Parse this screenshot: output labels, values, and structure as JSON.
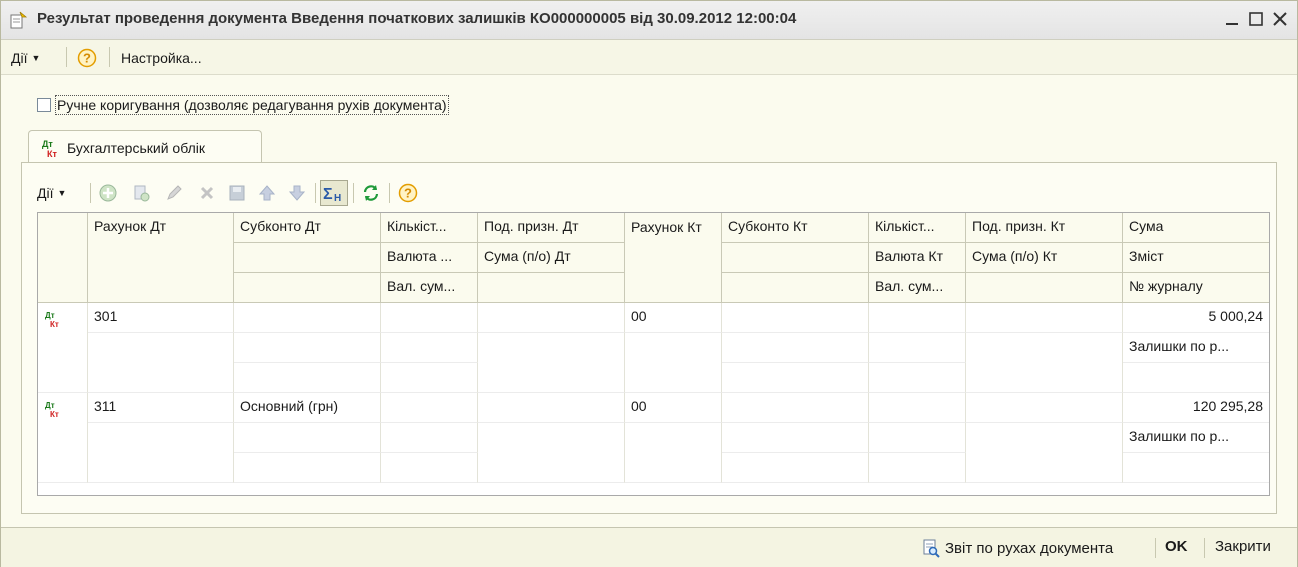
{
  "window": {
    "title": "Результат проведення документа Введення початкових залишків КО000000005 від 30.09.2012 12:00:04"
  },
  "main_toolbar": {
    "actions_label": "Дії",
    "settings_label": "Настройка..."
  },
  "manual_edit": {
    "label": "Ручне коригування (дозволяє редагування рухів документа)",
    "checked": false
  },
  "tabs": [
    {
      "label": "Бухгалтерський облік",
      "icon": "dt-kt-icon",
      "active": true
    }
  ],
  "inner_toolbar": {
    "actions_label": "Дії",
    "icons": [
      "add-icon",
      "copy-icon",
      "edit-icon",
      "delete-icon",
      "post-icon",
      "move-up-icon",
      "move-down-icon",
      "sum-icon",
      "refresh-icon",
      "help-icon"
    ]
  },
  "table": {
    "headers": {
      "account_dt": "Рахунок Дт",
      "subconto_dt": "Субконто Дт",
      "qty_dt": "Кількіст...",
      "currency_dt": "Валюта ...",
      "cur_sum_dt": "Вал. сум...",
      "tax_dt": "Под. призн. Дт",
      "sum_tax_dt": "Сума (п/о) Дт",
      "account_kt": "Рахунок Кт",
      "subconto_kt": "Субконто Кт",
      "qty_kt": "Кількіст...",
      "currency_kt": "Валюта Кт",
      "cur_sum_kt": "Вал. сум...",
      "tax_kt": "Под. призн. Кт",
      "sum_tax_kt": "Сума (п/о) Кт",
      "amount": "Сума",
      "content": "Зміст",
      "journal_no": "№ журналу"
    },
    "rows": [
      {
        "account_dt": "301",
        "subconto_dt": "",
        "account_kt": "00",
        "amount": "5 000,24",
        "content": "Залишки по р..."
      },
      {
        "account_dt": "311",
        "subconto_dt": "Основний (грн)",
        "account_kt": "00",
        "amount": "120 295,28",
        "content": "Залишки по р..."
      }
    ]
  },
  "bottom_bar": {
    "report_label": "Звіт по рухах документа",
    "ok_label": "OK",
    "close_label": "Закрити"
  },
  "colors": {
    "window_bg": "#fbfbee",
    "dt_icon": "#1a7a1a",
    "kt_icon": "#d02020",
    "help_icon": "#f0a000"
  }
}
